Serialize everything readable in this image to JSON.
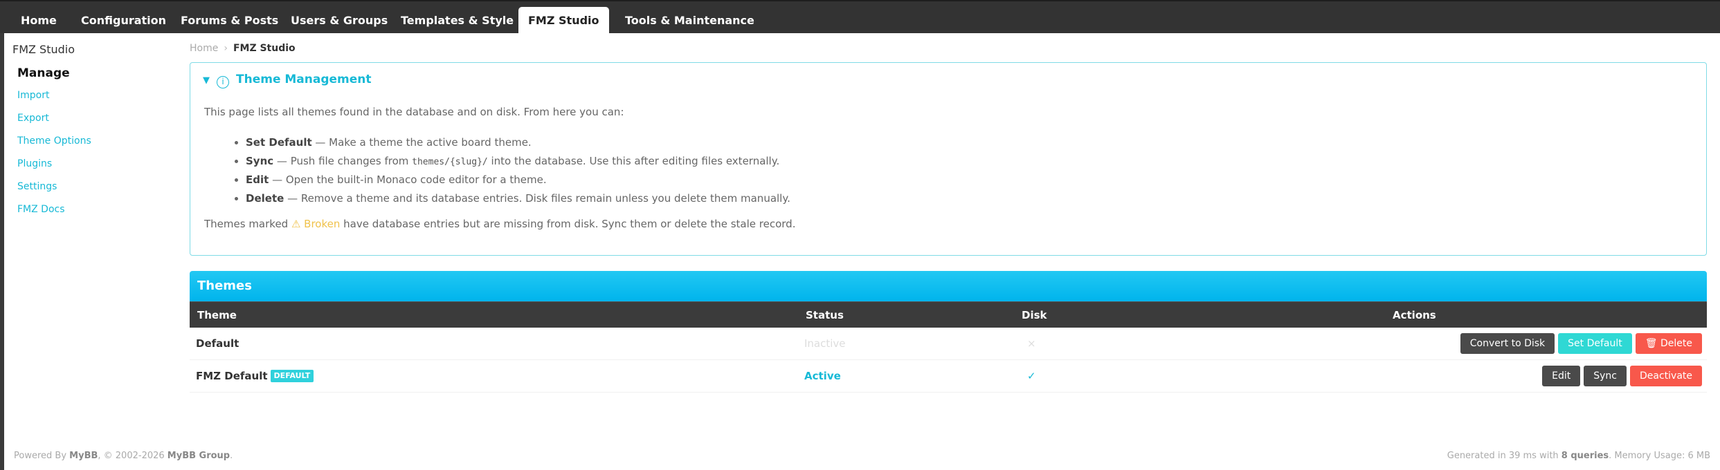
{
  "nav": {
    "tabs": [
      {
        "label": "Home"
      },
      {
        "label": "Configuration"
      },
      {
        "label": "Forums & Posts"
      },
      {
        "label": "Users & Groups"
      },
      {
        "label": "Templates & Style"
      },
      {
        "label": "FMZ Studio",
        "active": true
      },
      {
        "label": "Tools & Maintenance"
      }
    ]
  },
  "sidebar": {
    "title": "FMZ Studio",
    "heading": "Manage",
    "links": [
      "Import",
      "Export",
      "Theme Options",
      "Plugins",
      "Settings",
      "FMZ Docs"
    ]
  },
  "breadcrumb": {
    "home": "Home",
    "current": "FMZ Studio"
  },
  "info": {
    "title": "Theme Management",
    "intro": "This page lists all themes found in the database and on disk. From here you can:",
    "items": [
      {
        "term": "Set Default",
        "desc": " — Make a theme the active board theme."
      },
      {
        "term": "Sync",
        "desc_before": " — Push file changes from ",
        "code": "themes/{slug}/",
        "desc_after": " into the database. Use this after editing files externally."
      },
      {
        "term": "Edit",
        "desc": " — Open the built-in Monaco code editor for a theme."
      },
      {
        "term": "Delete",
        "desc": " — Remove a theme and its database entries. Disk files remain unless you delete them manually."
      }
    ],
    "outro_before": "Themes marked ",
    "outro_broken": "⚠ Broken",
    "outro_after": " have database entries but are missing from disk. Sync them or delete the stale record."
  },
  "themes": {
    "title": "Themes",
    "columns": {
      "theme": "Theme",
      "status": "Status",
      "disk": "Disk",
      "actions": "Actions"
    },
    "rows": [
      {
        "name": "Default",
        "badge": "",
        "status": "Inactive",
        "disk": "×",
        "actions": {
          "convert": "Convert to Disk",
          "set_default": "Set Default",
          "delete": "Delete"
        }
      },
      {
        "name": "FMZ Default",
        "badge": "DEFAULT",
        "status": "Active",
        "disk": "✓",
        "actions": {
          "edit": "Edit",
          "sync": "Sync",
          "deactivate": "Deactivate"
        }
      }
    ]
  },
  "footer": {
    "powered_prefix": "Powered By ",
    "mybb": "MyBB",
    "copyright": ", © 2002-2026 ",
    "group": "MyBB Group",
    "period": ".",
    "generated_prefix": "Generated in 39 ms with ",
    "queries": "8 queries",
    "memory": ". Memory Usage: 6 MB"
  },
  "colors": {
    "accent": "#17b9d6",
    "header": "#333333",
    "danger": "#f8584b",
    "teal": "#2fd8d4",
    "warning": "#f0c24b"
  }
}
